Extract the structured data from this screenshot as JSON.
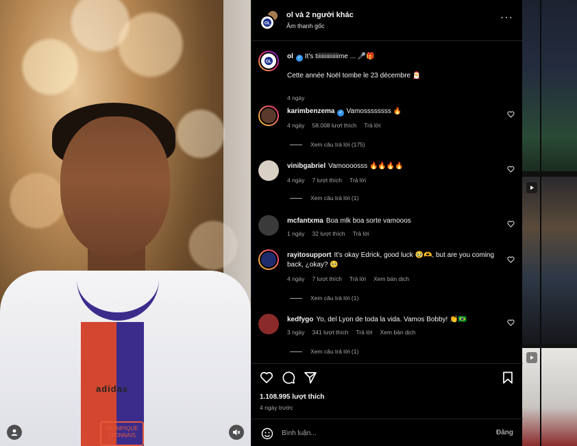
{
  "header": {
    "title_user": "ol",
    "title_rest": "và 2 người khác",
    "subtitle": "Âm thanh gốc"
  },
  "caption": {
    "user": "ol",
    "text": "It's tiiiiiiiiiiiiiime ... 🎤🎁",
    "line2": "Cette année Noël tombe le 23 décembre 🎅",
    "time": "4 ngày"
  },
  "comments": [
    {
      "user": "karimbenzema",
      "verified": true,
      "text": "Vamossssssss 🔥",
      "time": "4 ngày",
      "likes": "58.008 lượt thích",
      "reply": "Trả lời",
      "translate": "",
      "replies": "Xem câu trả lời (175)",
      "avatar_color": "#5a3a2a"
    },
    {
      "user": "vinibgabriel",
      "verified": false,
      "text": "Vamoooosss 🔥🔥🔥🔥",
      "time": "4 ngày",
      "likes": "7 lượt thích",
      "reply": "Trả lời",
      "translate": "",
      "replies": "Xem câu trả lời (1)",
      "avatar_color": "#d8d0c4"
    },
    {
      "user": "mcfantxma",
      "verified": false,
      "text": "Boa mlk boa sorte vamooos",
      "time": "1 ngày",
      "likes": "32 lượt thích",
      "reply": "Trả lời",
      "translate": "",
      "replies": "",
      "avatar_color": "#3a3a3a"
    },
    {
      "user": "rayitosupport",
      "verified": false,
      "text": "It's okay Edrick, good luck 🥹🫶, but are you coming back, ¿okay? 🥺",
      "time": "4 ngày",
      "likes": "7 lượt thích",
      "reply": "Trả lời",
      "translate": "Xem bản dịch",
      "replies": "Xem câu trả lời (1)",
      "avatar_color": "#1e2c6e"
    },
    {
      "user": "kedfygo",
      "verified": false,
      "text": "Yo, del Lyon de toda la vida. Vamos Bobby! 👏🇧🇷",
      "time": "3 ngày",
      "likes": "341 lượt thích",
      "reply": "Trả lời",
      "translate": "Xem bản dịch",
      "replies": "Xem câu trả lời (1)",
      "avatar_color": "#8a2a2a"
    }
  ],
  "footer": {
    "likes": "1.108.995 lượt thích",
    "date": "4 ngày trước",
    "comment_placeholder": "Bình luận...",
    "post_label": "Đăng"
  },
  "video": {
    "crest_text": "OLYMPIQUE LYONNAIS",
    "brand_text": "adidas"
  },
  "colors": {
    "panel_bg": "#000000",
    "muted_text": "#a8a8a8",
    "verified_blue": "#3897f0"
  }
}
